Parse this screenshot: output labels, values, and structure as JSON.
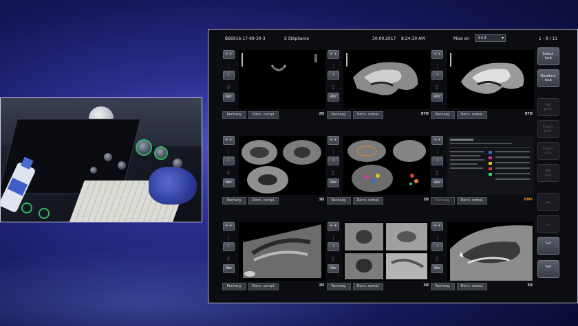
{
  "header": {
    "patient_id": "B66916-17-09-30-3",
    "patient_name": "S Stéphanie",
    "date": "30.09.2017",
    "time": "8:24:30 AM",
    "layout_label": "Mise en",
    "layout_value": "3×3",
    "page_counter": "1 - 9 / 11"
  },
  "cells": [
    {
      "id": 1,
      "mode": "2D",
      "mode_color": "#e2e2e2",
      "recharge": "Recharg.",
      "compl": "Donn. compl."
    },
    {
      "id": 2,
      "mode": "XTD",
      "mode_color": "#e2e2e2",
      "recharge": "Recharg.",
      "compl": "Donn. compl."
    },
    {
      "id": 3,
      "mode": "XTD",
      "mode_color": "#e2e2e2",
      "recharge": "Recharg.",
      "compl": "Donn. compl."
    },
    {
      "id": 4,
      "mode": "3D",
      "mode_color": "#e2e2e2",
      "recharge": "Recharg.",
      "compl": "Donn. compl."
    },
    {
      "id": 5,
      "mode": "3D",
      "mode_color": "#e2e2e2",
      "recharge": "Recharg.",
      "compl": "Donn. compl."
    },
    {
      "id": 6,
      "mode": "BMP",
      "mode_color": "#e08a2a",
      "recharge": "Recharg.",
      "compl": "Donn. compl."
    },
    {
      "id": 7,
      "mode": "2D",
      "mode_color": "#e2e2e2",
      "recharge": "Recharg.",
      "compl": "Donn. compl."
    },
    {
      "id": 8,
      "mode": "3D",
      "mode_color": "#e2e2e2",
      "recharge": "Recharg.",
      "compl": "Donn. compl."
    },
    {
      "id": 9,
      "mode": "3D",
      "mode_color": "#e2e2e2",
      "recharge": "Recharg.",
      "compl": "Donn. compl."
    }
  ],
  "tool_labels": {
    "top": "+ +",
    "info": "i",
    "abc": "Abc"
  },
  "sidebar": {
    "select_all": [
      "Sélect.",
      "tout"
    ],
    "deselect_all": [
      "Désélect.",
      "tout"
    ],
    "pat_prev": [
      "Pat.",
      "préc."
    ],
    "exam_prev": [
      "Exam.",
      "préc."
    ],
    "exam_next": [
      "Exam.",
      "suiv."
    ],
    "pat_next": [
      "Pat.",
      "suiv."
    ]
  },
  "colors": {
    "accent_orange": "#e08a2a",
    "button_grey": "#3a3c44",
    "monitor_bg": "#0c0d10"
  }
}
